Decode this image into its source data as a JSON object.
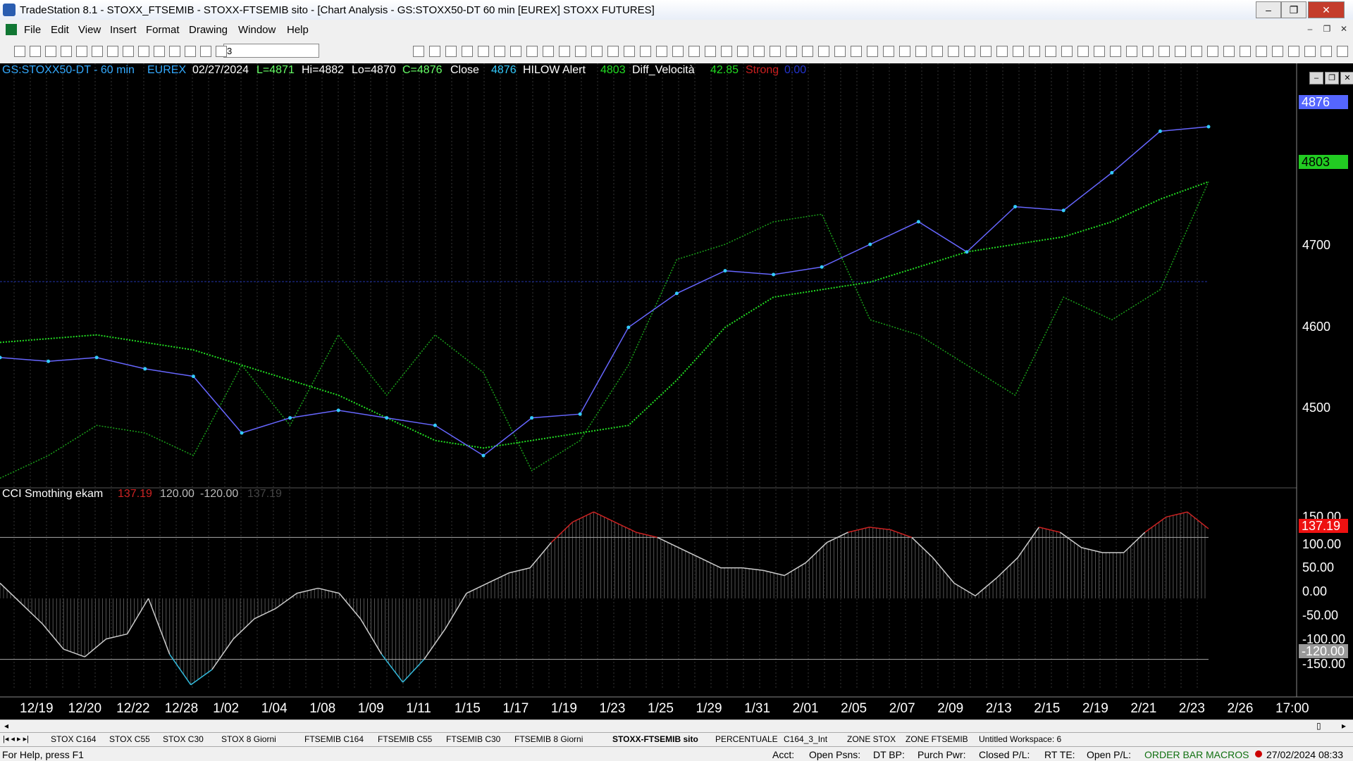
{
  "window": {
    "title": "TradeStation 8.1 - STOXX_FTSEMIB - STOXX-FTSEMIB sito - [Chart Analysis - GS:STOXX50-DT  60 min  [EUREX] STOXX FUTURES]",
    "minimize": "–",
    "restore": "❐",
    "close": "✕"
  },
  "menu": [
    "File",
    "Edit",
    "View",
    "Insert",
    "Format",
    "Drawing",
    "Window",
    "Help"
  ],
  "mdi": {
    "minimize": "–",
    "restore": "❐",
    "close": "✕"
  },
  "toolbar": {
    "select_value": "3"
  },
  "chart_header": {
    "symbol": "GS:STOXX50-DT - 60 min",
    "exchange": "EUREX",
    "date": "02/27/2024",
    "low": "L=4871",
    "high": "Hi=4882",
    "lo": "Lo=4870",
    "close": "C=4876",
    "close_label": "Close",
    "close_value": "4876",
    "alert_label": "HILOW Alert",
    "alert_value": "4803",
    "diff_label": "Diff_Velocità",
    "diff_value": "42.85",
    "strong_label": "Strong",
    "strong_value": "0.00"
  },
  "price_boxes": {
    "last": "4876",
    "ma": "4803"
  },
  "price_axis": [
    "4700",
    "4600",
    "4500"
  ],
  "indicator_header": {
    "name": "CCI Smothing ekam",
    "v1": "137.19",
    "v2": "120.00",
    "v3": "-120.00",
    "v4": "137.19"
  },
  "indicator_axis": [
    "150.00",
    "100.00",
    "50.00",
    "0.00",
    "-50.00",
    "-100.00",
    "-150.00"
  ],
  "indicator_boxes": {
    "value": "137.19",
    "upper": "120.00",
    "lower": "-120.00"
  },
  "date_axis": [
    "12/19",
    "12/20",
    "12/22",
    "12/28",
    "1/02",
    "1/04",
    "1/08",
    "1/09",
    "1/11",
    "1/15",
    "1/17",
    "1/19",
    "1/23",
    "1/25",
    "1/29",
    "1/31",
    "2/01",
    "2/05",
    "2/07",
    "2/09",
    "2/13",
    "2/15",
    "2/19",
    "2/21",
    "2/23",
    "2/26",
    "17:00"
  ],
  "workspace_tabs": [
    "STOX C164",
    "STOX C55",
    "STOX  C30",
    "STOX  8 Giorni",
    "FTSEMIB C164",
    "FTSEMIB C55",
    "FTSEMIB C30",
    "FTSEMIB  8 Giorni",
    "STOXX-FTSEMIB sito",
    "PERCENTUALE",
    "C164_3_Int",
    "ZONE STOX",
    "ZONE FTSEMIB",
    "Untitled Workspace:  6"
  ],
  "active_tab": "STOXX-FTSEMIB sito",
  "status": {
    "help": "For Help, press F1",
    "acct": "Acct:",
    "open_psns": "Open Psns:",
    "dt_bp": "DT BP:",
    "purch_pwr": "Purch Pwr:",
    "closed_pl": "Closed P/L:",
    "rt_te": "RT TE:",
    "open_pl": "Open P/L:",
    "order_bar": "ORDER BAR",
    "macros": "MACROS",
    "datetime": "27/02/2024 08:33"
  },
  "colors": {
    "price": "#33ccff",
    "ma_red": "#cc1f1f",
    "ma_green": "#22dd22",
    "cci": "#cccccc",
    "cci_hi": "#cc2222",
    "cci_lo": "#33bbdd",
    "alert": "#1aa01a",
    "alert_hi": "#c8c800",
    "alert_lo": "#aa1a1a"
  },
  "chart_data": {
    "type": "line",
    "price_ylim": [
      4400,
      4960
    ],
    "series": [
      {
        "name": "Close",
        "x": [
          "12/19",
          "12/20",
          "12/22",
          "12/28",
          "1/02",
          "1/04",
          "1/08",
          "1/09",
          "1/11",
          "1/15",
          "1/17",
          "1/19",
          "1/23",
          "1/25",
          "1/29",
          "1/31",
          "2/01",
          "2/05",
          "2/07",
          "2/09",
          "2/13",
          "2/15",
          "2/19",
          "2/21",
          "2/23",
          "2/26"
        ],
        "values": [
          4570,
          4565,
          4570,
          4555,
          4545,
          4470,
          4490,
          4500,
          4490,
          4480,
          4440,
          4490,
          4495,
          4610,
          4655,
          4685,
          4680,
          4690,
          4720,
          4750,
          4710,
          4770,
          4765,
          4815,
          4870,
          4876
        ]
      },
      {
        "name": "HILOW Alert",
        "values": [
          4410,
          4440,
          4480,
          4470,
          4440,
          4560,
          4480,
          4600,
          4520,
          4600,
          4550,
          4420,
          4460,
          4560,
          4700,
          4720,
          4750,
          4760,
          4620,
          4600,
          4560,
          4520,
          4650,
          4620,
          4660,
          4803
        ]
      },
      {
        "name": "Diff_Velocità",
        "values": [
          4590,
          4595,
          4600,
          4590,
          4580,
          4560,
          4540,
          4520,
          4490,
          4460,
          4450,
          4460,
          4470,
          4480,
          4540,
          4610,
          4650,
          4660,
          4670,
          4690,
          4710,
          4720,
          4730,
          4750,
          4780,
          4803
        ]
      }
    ],
    "cci": {
      "ylim": [
        -180,
        180
      ],
      "upper": 120,
      "lower": -120,
      "values": [
        30,
        -10,
        -50,
        -100,
        -115,
        -80,
        -70,
        0,
        -110,
        -170,
        -140,
        -80,
        -40,
        -20,
        10,
        20,
        10,
        -40,
        -110,
        -165,
        -120,
        -60,
        10,
        30,
        50,
        60,
        110,
        150,
        170,
        150,
        130,
        120,
        100,
        80,
        60,
        60,
        55,
        45,
        70,
        110,
        130,
        140,
        135,
        120,
        80,
        30,
        5,
        40,
        80,
        140,
        130,
        100,
        90,
        90,
        130,
        160,
        170,
        137
      ]
    }
  }
}
